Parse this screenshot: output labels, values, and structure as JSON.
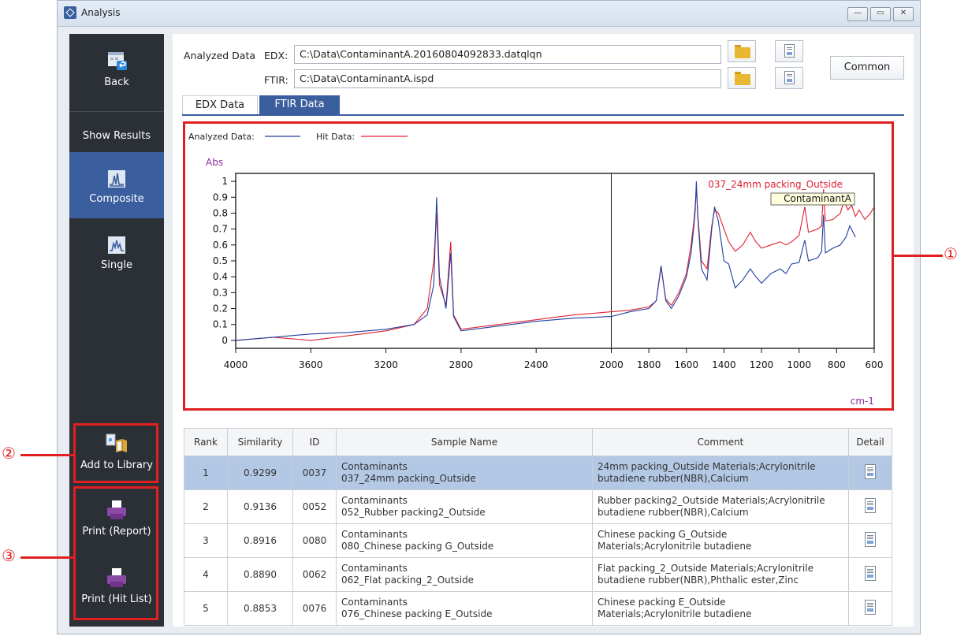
{
  "window": {
    "title": "Analysis"
  },
  "sidebar": {
    "back_label": "Back",
    "show_results_label": "Show Results",
    "composite_label": "Composite",
    "single_label": "Single",
    "add_to_library_label": "Add to Library",
    "print_report_label": "Print (Report)",
    "print_hitlist_label": "Print (Hit List)"
  },
  "callouts": [
    "①",
    "②",
    "③"
  ],
  "header": {
    "analyzed_data_label": "Analyzed Data",
    "edx_label": "EDX:",
    "edx_path": "C:\\Data\\ContaminantA.20160804092833.datqlqn",
    "ftir_label": "FTIR:",
    "ftir_path": "C:\\Data\\ContaminantA.ispd",
    "common_button": "Common"
  },
  "tabs": [
    {
      "label": "EDX Data",
      "active": false
    },
    {
      "label": "FTIR Data",
      "active": true
    }
  ],
  "chart_data": {
    "type": "line",
    "legend": [
      {
        "name": "Analyzed Data:",
        "color": "#1f3fa0"
      },
      {
        "name": "Hit Data:",
        "color": "#e02030"
      }
    ],
    "ylabel": "Abs",
    "xlabel": "cm-1",
    "x_reversed": true,
    "xlim": [
      4000,
      600
    ],
    "ylim": [
      -0.05,
      1.05
    ],
    "xticks": [
      4000,
      3600,
      3200,
      2800,
      2400,
      2000,
      1800,
      1600,
      1400,
      1200,
      1000,
      800,
      600
    ],
    "yticks": [
      0,
      0.1,
      0.2,
      0.3,
      0.4,
      0.5,
      0.6,
      0.7,
      0.8,
      0.9,
      1
    ],
    "cursor_x": 2000,
    "hit_annotation": "037_24mm packing_Outside",
    "analyzed_annotation": "ContaminantA",
    "series": [
      {
        "name": "Analyzed Data",
        "color": "#1f3fa0",
        "points": [
          [
            4000,
            0.0
          ],
          [
            3800,
            0.02
          ],
          [
            3600,
            0.04
          ],
          [
            3400,
            0.05
          ],
          [
            3200,
            0.07
          ],
          [
            3050,
            0.1
          ],
          [
            2980,
            0.16
          ],
          [
            2945,
            0.35
          ],
          [
            2930,
            0.9
          ],
          [
            2915,
            0.4
          ],
          [
            2880,
            0.2
          ],
          [
            2855,
            0.55
          ],
          [
            2840,
            0.15
          ],
          [
            2800,
            0.06
          ],
          [
            2600,
            0.09
          ],
          [
            2400,
            0.12
          ],
          [
            2200,
            0.14
          ],
          [
            2000,
            0.15
          ],
          [
            1900,
            0.18
          ],
          [
            1800,
            0.2
          ],
          [
            1760,
            0.25
          ],
          [
            1735,
            0.47
          ],
          [
            1710,
            0.25
          ],
          [
            1680,
            0.2
          ],
          [
            1640,
            0.28
          ],
          [
            1600,
            0.4
          ],
          [
            1575,
            0.55
          ],
          [
            1560,
            0.72
          ],
          [
            1553,
            0.82
          ],
          [
            1547,
            1.0
          ],
          [
            1540,
            0.78
          ],
          [
            1520,
            0.45
          ],
          [
            1490,
            0.38
          ],
          [
            1465,
            0.7
          ],
          [
            1450,
            0.84
          ],
          [
            1430,
            0.75
          ],
          [
            1400,
            0.5
          ],
          [
            1375,
            0.48
          ],
          [
            1340,
            0.33
          ],
          [
            1300,
            0.38
          ],
          [
            1260,
            0.45
          ],
          [
            1230,
            0.4
          ],
          [
            1200,
            0.36
          ],
          [
            1150,
            0.42
          ],
          [
            1100,
            0.45
          ],
          [
            1070,
            0.42
          ],
          [
            1040,
            0.48
          ],
          [
            1000,
            0.49
          ],
          [
            970,
            0.63
          ],
          [
            950,
            0.5
          ],
          [
            900,
            0.52
          ],
          [
            880,
            0.56
          ],
          [
            870,
            0.79
          ],
          [
            860,
            0.55
          ],
          [
            820,
            0.58
          ],
          [
            780,
            0.6
          ],
          [
            750,
            0.65
          ],
          [
            730,
            0.72
          ],
          [
            700,
            0.65
          ]
        ]
      },
      {
        "name": "Hit Data",
        "color": "#e02030",
        "points": [
          [
            4000,
            0.0
          ],
          [
            3800,
            0.02
          ],
          [
            3600,
            0.0
          ],
          [
            3400,
            0.03
          ],
          [
            3200,
            0.06
          ],
          [
            3050,
            0.1
          ],
          [
            2980,
            0.2
          ],
          [
            2945,
            0.5
          ],
          [
            2930,
            0.8
          ],
          [
            2915,
            0.35
          ],
          [
            2880,
            0.22
          ],
          [
            2855,
            0.62
          ],
          [
            2840,
            0.16
          ],
          [
            2800,
            0.07
          ],
          [
            2600,
            0.1
          ],
          [
            2400,
            0.13
          ],
          [
            2200,
            0.16
          ],
          [
            2000,
            0.18
          ],
          [
            1900,
            0.19
          ],
          [
            1800,
            0.21
          ],
          [
            1760,
            0.25
          ],
          [
            1735,
            0.46
          ],
          [
            1710,
            0.26
          ],
          [
            1680,
            0.22
          ],
          [
            1640,
            0.3
          ],
          [
            1600,
            0.42
          ],
          [
            1575,
            0.6
          ],
          [
            1560,
            0.75
          ],
          [
            1553,
            0.85
          ],
          [
            1547,
            0.96
          ],
          [
            1540,
            0.8
          ],
          [
            1520,
            0.5
          ],
          [
            1490,
            0.45
          ],
          [
            1465,
            0.72
          ],
          [
            1450,
            0.82
          ],
          [
            1430,
            0.8
          ],
          [
            1400,
            0.7
          ],
          [
            1375,
            0.62
          ],
          [
            1340,
            0.56
          ],
          [
            1300,
            0.6
          ],
          [
            1260,
            0.68
          ],
          [
            1230,
            0.62
          ],
          [
            1200,
            0.58
          ],
          [
            1150,
            0.6
          ],
          [
            1100,
            0.62
          ],
          [
            1070,
            0.6
          ],
          [
            1040,
            0.62
          ],
          [
            1000,
            0.66
          ],
          [
            970,
            0.84
          ],
          [
            950,
            0.68
          ],
          [
            900,
            0.7
          ],
          [
            880,
            0.72
          ],
          [
            870,
            0.95
          ],
          [
            860,
            0.75
          ],
          [
            820,
            0.76
          ],
          [
            780,
            0.8
          ],
          [
            760,
            0.88
          ],
          [
            740,
            0.82
          ],
          [
            720,
            0.85
          ],
          [
            700,
            0.78
          ],
          [
            680,
            0.82
          ],
          [
            650,
            0.76
          ],
          [
            620,
            0.8
          ],
          [
            600,
            0.84
          ]
        ]
      }
    ]
  },
  "table": {
    "columns": [
      "Rank",
      "Similarity",
      "ID",
      "Sample Name",
      "Comment",
      "Detail"
    ],
    "rows": [
      {
        "rank": "1",
        "similarity": "0.9299",
        "id": "0037",
        "name1": "Contaminants",
        "name2": "037_24mm packing_Outside",
        "comment1": "24mm packing_Outside Materials;Acrylonitrile",
        "comment2": "butadiene rubber(NBR),Calcium"
      },
      {
        "rank": "2",
        "similarity": "0.9136",
        "id": "0052",
        "name1": "Contaminants",
        "name2": "052_Rubber packing2_Outside",
        "comment1": "Rubber packing2_Outside Materials;Acrylonitrile",
        "comment2": "butadiene rubber(NBR),Calcium"
      },
      {
        "rank": "3",
        "similarity": "0.8916",
        "id": "0080",
        "name1": "Contaminants",
        "name2": "080_Chinese packing G_Outside",
        "comment1": "Chinese packing G_Outside",
        "comment2": "Materials;Acrylonitrile butadiene"
      },
      {
        "rank": "4",
        "similarity": "0.8890",
        "id": "0062",
        "name1": "Contaminants",
        "name2": "062_Flat packing_2_Outside",
        "comment1": "Flat packing_2_Outside Materials;Acrylonitrile",
        "comment2": "butadiene rubber(NBR),Phthalic ester,Zinc"
      },
      {
        "rank": "5",
        "similarity": "0.8853",
        "id": "0076",
        "name1": "Contaminants",
        "name2": "076_Chinese packing E_Outside",
        "comment1": "Chinese packing E_Outside",
        "comment2": "Materials;Acrylonitrile butadiene"
      }
    ]
  }
}
